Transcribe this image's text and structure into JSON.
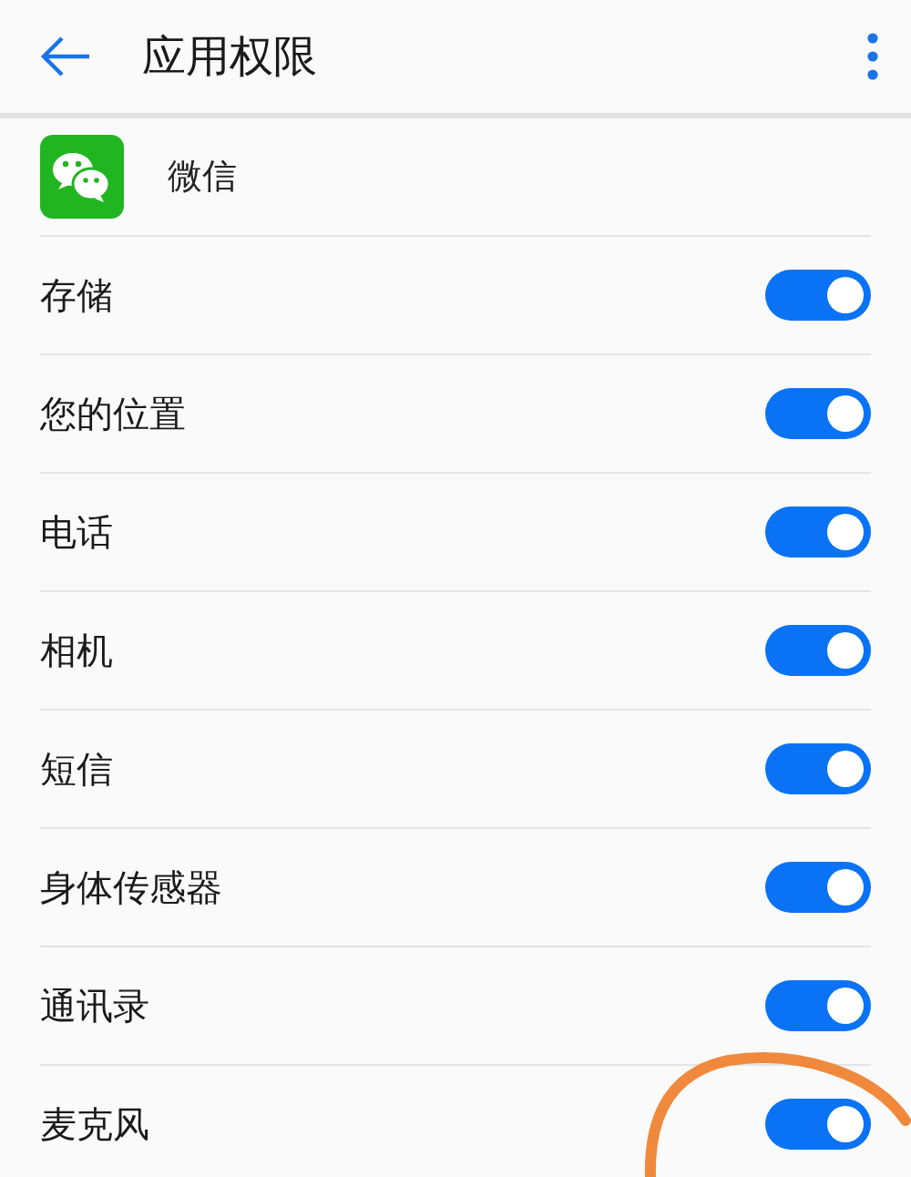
{
  "header": {
    "title": "应用权限"
  },
  "app": {
    "name": "微信"
  },
  "permissions": [
    {
      "label": "存储",
      "on": true
    },
    {
      "label": "您的位置",
      "on": true
    },
    {
      "label": "电话",
      "on": true
    },
    {
      "label": "相机",
      "on": true
    },
    {
      "label": "短信",
      "on": true
    },
    {
      "label": "身体传感器",
      "on": true
    },
    {
      "label": "通讯录",
      "on": true
    },
    {
      "label": "麦克风",
      "on": true
    }
  ]
}
